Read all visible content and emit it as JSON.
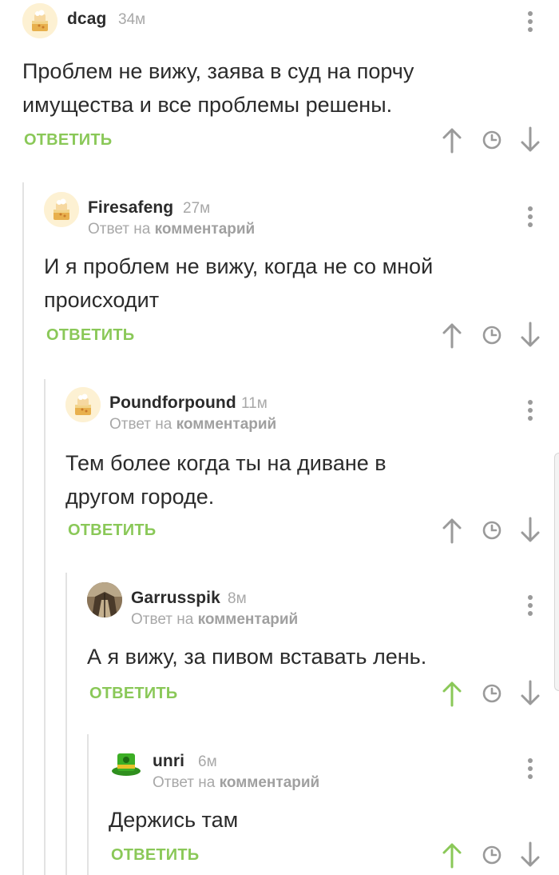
{
  "comments": [
    {
      "username": "dcag",
      "time": "34м",
      "text": "Проблем не вижу, заява в суд на порчу имущества и все проблемы решены.",
      "reply_to": null,
      "reply_label": "ОТВЕТИТЬ",
      "upvote_active": false,
      "avatar": "default-cake-avatar"
    },
    {
      "username": "Firesafeng",
      "time": "27м",
      "text": "И я проблем не вижу, когда не со мной происходит",
      "reply_to": {
        "prefix": "Ответ на",
        "link": "комментарий"
      },
      "reply_label": "ОТВЕТИТЬ",
      "upvote_active": false,
      "avatar": "default-cake-avatar"
    },
    {
      "username": "Poundforpound",
      "time": "11м",
      "text": "Тем более когда ты на диване в другом городе.",
      "reply_to": {
        "prefix": "Ответ на",
        "link": "комментарий"
      },
      "reply_label": "ОТВЕТИТЬ",
      "upvote_active": false,
      "avatar": "default-cake-avatar"
    },
    {
      "username": "Garrusspik",
      "time": "8м",
      "text": "А я вижу, за пивом вставать лень.",
      "reply_to": {
        "prefix": "Ответ на",
        "link": "комментарий"
      },
      "reply_label": "ОТВЕТИТЬ",
      "upvote_active": true,
      "avatar": "photo-avatar"
    },
    {
      "username": "unri",
      "time": "6м",
      "text": "Держись там",
      "reply_to": {
        "prefix": "Ответ на",
        "link": "комментарий"
      },
      "reply_label": "ОТВЕТИТЬ",
      "upvote_active": true,
      "avatar": "green-top-hat-avatar"
    }
  ],
  "icons": {
    "upvote": "arrow-up-icon",
    "downvote": "arrow-down-icon",
    "save": "clock-icon",
    "menu": "more-vertical-icon"
  },
  "colors": {
    "accent_green": "#8ac858",
    "icon_gray": "#9a9a9a",
    "meta_gray": "#a8a8a8",
    "text": "#2b2b2b",
    "thread_line": "#e3e3e3"
  }
}
